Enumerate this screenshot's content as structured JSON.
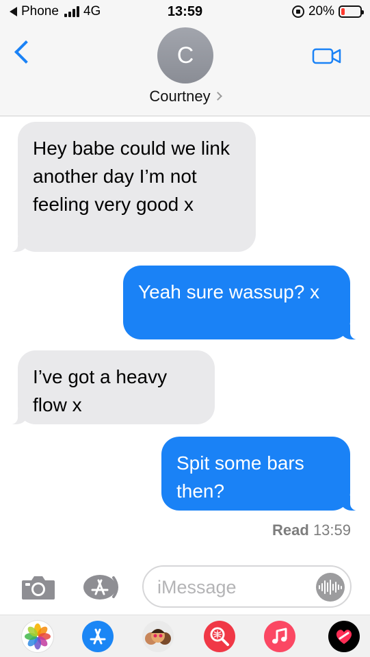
{
  "status_bar": {
    "carrier": "Phone",
    "network": "4G",
    "time": "13:59",
    "battery_percent": "20%",
    "battery_level": 0.2
  },
  "header": {
    "avatar_initial": "C",
    "contact_name": "Courtney"
  },
  "messages": [
    {
      "direction": "incoming",
      "text": "Hey babe could we link another day I’m not feeling very good x"
    },
    {
      "direction": "outgoing",
      "text": "Yeah sure wassup? x"
    },
    {
      "direction": "incoming",
      "text": "I’ve got a heavy flow x"
    },
    {
      "direction": "outgoing",
      "text": "Spit some bars then?"
    }
  ],
  "read_receipt": {
    "label": "Read",
    "time": "13:59"
  },
  "composer": {
    "placeholder": "iMessage"
  },
  "icons": [
    "back-chevron-icon",
    "video-camera-icon",
    "camera-icon",
    "app-store-icon",
    "audio-waveform-icon",
    "photos-icon",
    "memoji-icon",
    "web-search-icon",
    "music-icon",
    "heart-icon"
  ],
  "colors": {
    "accent_blue": "#1a82f6",
    "incoming_bubble": "#e9e9eb",
    "battery_low": "#ff3b30"
  }
}
